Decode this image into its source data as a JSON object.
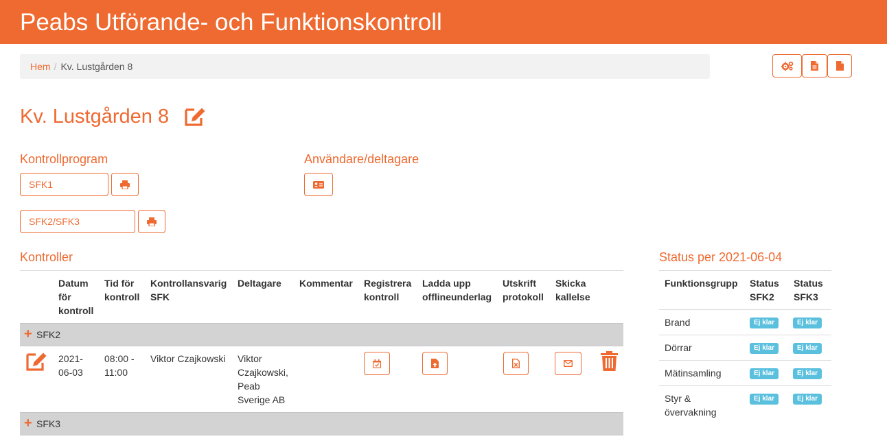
{
  "app": {
    "title": "Peabs Utförande- och Funktionskontroll"
  },
  "breadcrumb": {
    "home": "Hem",
    "current": "Kv. Lustgården 8"
  },
  "toolbar": {
    "icons": [
      "gears-icon",
      "document-lines-icon",
      "document-icon"
    ]
  },
  "page": {
    "title": "Kv. Lustgården 8"
  },
  "kontrollprogram": {
    "title": "Kontrollprogram",
    "items": [
      {
        "label": "SFK1"
      },
      {
        "label": "SFK2/SFK3"
      }
    ]
  },
  "users": {
    "title": "Användare/deltagare"
  },
  "kontroller": {
    "title": "Kontroller",
    "headers": {
      "datum": [
        "Datum",
        "för",
        "kontroll"
      ],
      "tid": [
        "Tid för",
        "kontroll"
      ],
      "ansvarig": [
        "Kontrollansvarig",
        "SFK"
      ],
      "deltagare": [
        "Deltagare"
      ],
      "kommentar": [
        "Kommentar"
      ],
      "registrera": [
        "Registrera",
        "kontroll"
      ],
      "ladda": [
        "Ladda upp",
        "offlineunderlag"
      ],
      "utskrift": [
        "Utskrift",
        "protokoll"
      ],
      "skicka": [
        "Skicka",
        "kallelse"
      ]
    },
    "groups": [
      {
        "label": "SFK2"
      },
      {
        "label": "SFK3"
      }
    ],
    "row": {
      "datum": [
        "2021-",
        "06-03"
      ],
      "tid": [
        "08:00 -",
        "11:00"
      ],
      "ansvarig": "Viktor Czajkowski",
      "deltagare": [
        "Viktor",
        "Czajkowski,",
        "Peab",
        "Sverige AB"
      ]
    }
  },
  "status": {
    "title": "Status per 2021-06-04",
    "headers": {
      "grupp": "Funktionsgrupp",
      "sfk2": [
        "Status",
        "SFK2"
      ],
      "sfk3": [
        "Status",
        "SFK3"
      ]
    },
    "rows": [
      {
        "name": [
          "Brand"
        ],
        "sfk2": "Ej klar",
        "sfk3": "Ej klar"
      },
      {
        "name": [
          "Dörrar"
        ],
        "sfk2": "Ej klar",
        "sfk3": "Ej klar"
      },
      {
        "name": [
          "Mätinsamling"
        ],
        "sfk2": "Ej klar",
        "sfk3": "Ej klar"
      },
      {
        "name": [
          "Styr &",
          "övervakning"
        ],
        "sfk2": "Ej klar",
        "sfk3": "Ej klar"
      }
    ]
  },
  "colors": {
    "accent": "#ee6a31",
    "badge": "#5bc0de",
    "group_row": "#d3d3d3"
  }
}
